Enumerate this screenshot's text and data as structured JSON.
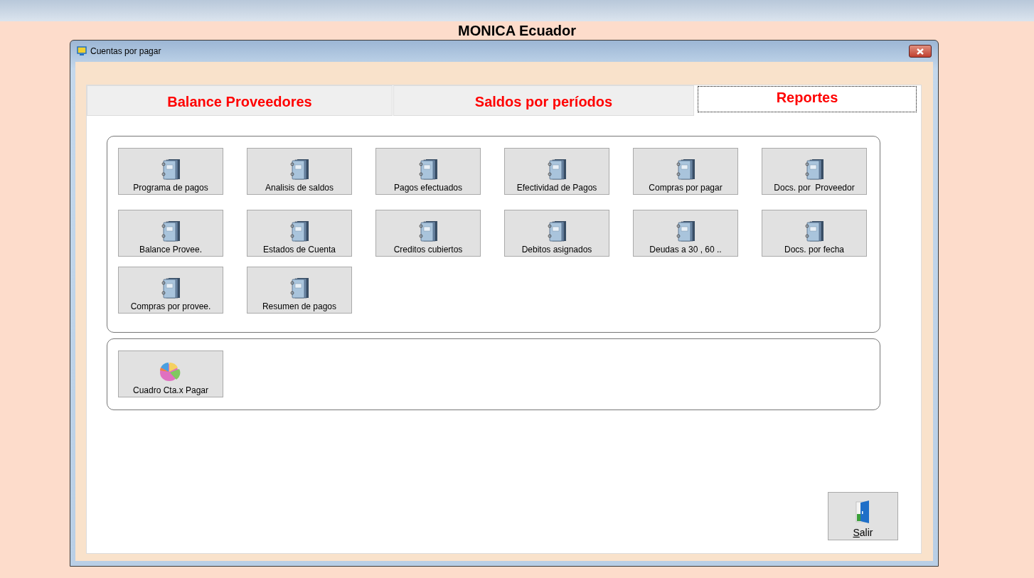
{
  "app_title": "MONICA Ecuador",
  "window": {
    "title": "Cuentas por pagar"
  },
  "tabs": [
    {
      "label": "Balance Proveedores",
      "selected": false
    },
    {
      "label": "Saldos por períodos",
      "selected": false
    },
    {
      "label": "Reportes",
      "selected": true
    }
  ],
  "report_groups": [
    {
      "buttons": [
        {
          "label": "Programa de pagos",
          "kind": "book"
        },
        {
          "label": "Analisis de saldos",
          "kind": "book"
        },
        {
          "label": "Pagos efectuados",
          "kind": "book"
        },
        {
          "label": "Efectividad de Pagos",
          "kind": "book"
        },
        {
          "label": "Compras por pagar",
          "kind": "book"
        },
        {
          "label": "Docs. por  Proveedor",
          "kind": "book"
        },
        {
          "label": "Balance Provee.",
          "kind": "book"
        },
        {
          "label": "Estados de Cuenta",
          "kind": "book"
        },
        {
          "label": "Creditos cubiertos",
          "kind": "book"
        },
        {
          "label": "Debitos asignados",
          "kind": "book"
        },
        {
          "label": "Deudas a 30 , 60 ..",
          "kind": "book"
        },
        {
          "label": "Docs. por fecha",
          "kind": "book"
        },
        {
          "label": "Compras por provee.",
          "kind": "book"
        },
        {
          "label": "Resumen de pagos",
          "kind": "book"
        }
      ]
    },
    {
      "buttons": [
        {
          "label": "Cuadro Cta.x Pagar",
          "kind": "chart"
        }
      ]
    }
  ],
  "exit_button": {
    "label": "Salir"
  }
}
